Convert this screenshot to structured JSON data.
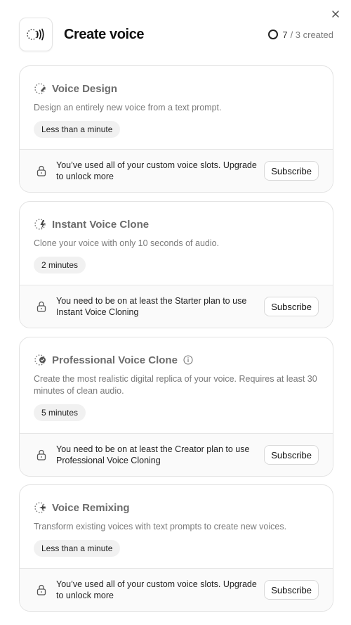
{
  "header": {
    "title": "Create voice",
    "count": "7",
    "count_rest": "/ 3 created"
  },
  "cards": [
    {
      "title": "Voice Design",
      "icon": "voice-design-icon",
      "description": "Design an entirely new voice from a text prompt.",
      "duration": "Less than a minute",
      "lock_message": "You’ve used all of your custom voice slots. Upgrade to unlock more",
      "button": "Subscribe"
    },
    {
      "title": "Instant Voice Clone",
      "icon": "instant-voice-clone-icon",
      "description": "Clone your voice with only 10 seconds of audio.",
      "duration": "2 minutes",
      "lock_message": "You need to be on at least the Starter plan to use Instant Voice Cloning",
      "button": "Subscribe"
    },
    {
      "title": "Professional Voice Clone",
      "icon": "professional-voice-clone-icon",
      "description": "Create the most realistic digital replica of your voice. Requires at least 30 minutes of clean audio.",
      "duration": "5 minutes",
      "lock_message": "You need to be on at least the Creator plan to use Professional Voice Cloning",
      "button": "Subscribe"
    },
    {
      "title": "Voice Remixing",
      "icon": "voice-remixing-icon",
      "description": "Transform existing voices with text prompts to create new voices.",
      "duration": "Less than a minute",
      "lock_message": "You’ve used all of your custom voice slots. Upgrade to unlock more",
      "button": "Subscribe"
    }
  ]
}
